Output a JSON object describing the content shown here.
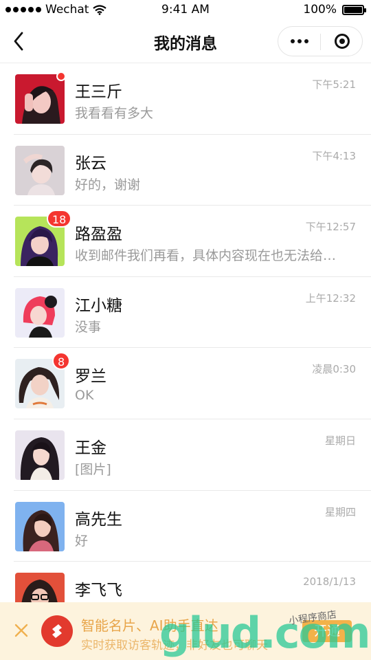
{
  "status_bar": {
    "carrier": "Wechat",
    "time": "9:41 AM",
    "battery": "100%",
    "battery_level": 1.0
  },
  "nav": {
    "title": "我的消息"
  },
  "messages": [
    {
      "name": "王三斤",
      "preview": "我看看有多大",
      "time": "下午5:21",
      "unread_dot": true,
      "badge": ""
    },
    {
      "name": "张云",
      "preview": "好的，谢谢",
      "time": "下午4:13",
      "unread_dot": false,
      "badge": ""
    },
    {
      "name": "路盈盈",
      "preview": "收到邮件我们再看，具体内容现在也无法给…",
      "time": "下午12:57",
      "unread_dot": false,
      "badge": "18"
    },
    {
      "name": "江小糖",
      "preview": "没事",
      "time": "上午12:32",
      "unread_dot": false,
      "badge": ""
    },
    {
      "name": "罗兰",
      "preview": "OK",
      "time": "凌晨0:30",
      "unread_dot": false,
      "badge": "8"
    },
    {
      "name": "王金",
      "preview": "[图片]",
      "time": "星期日",
      "unread_dot": false,
      "badge": ""
    },
    {
      "name": "高先生",
      "preview": "好",
      "time": "星期四",
      "unread_dot": false,
      "badge": ""
    },
    {
      "name": "李飞飞",
      "preview": "",
      "time": "2018/1/13",
      "unread_dot": false,
      "badge": ""
    }
  ],
  "ad": {
    "title": "智能名片、AI助手直达",
    "subtitle": "实时获取访客轨迹，非好友也可聊天",
    "button": "开通"
  },
  "watermark": {
    "main": "glud.com",
    "sub": "小程序商店"
  },
  "colors": {
    "badge": "#f43530",
    "ad_background": "#fdf3dd",
    "ad_accent": "#f2b24a",
    "watermark": "#28c896"
  },
  "icons": {
    "back": "chevron-left-icon",
    "more": "more-dots-icon",
    "close": "target-close-icon",
    "ad_close": "close-x-icon",
    "ad_logo": "brand-logo-icon"
  }
}
